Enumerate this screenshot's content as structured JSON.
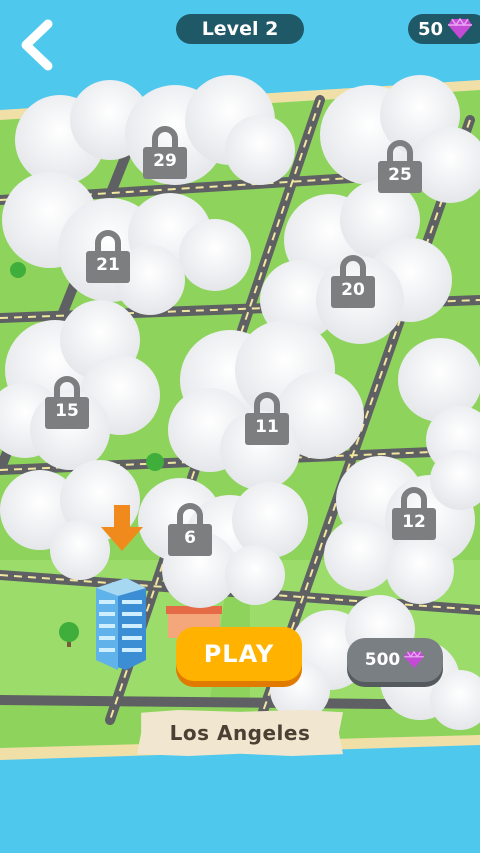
{
  "header": {
    "level_label": "Level 2",
    "gem_count": "50"
  },
  "levels": {
    "locked": [
      "29",
      "25",
      "21",
      "20",
      "15",
      "11",
      "12",
      "6"
    ]
  },
  "actions": {
    "play_label": "PLAY",
    "unlock_price": "500"
  },
  "city": {
    "name": "Los Angeles"
  },
  "colors": {
    "sky": "#4fc8ee",
    "grass": "#8ed45c",
    "road": "#5e6063",
    "play": "#ffb300",
    "gem": "#c44bd6",
    "lock": "#7c7e80"
  },
  "icons": [
    "back-arrow-icon",
    "gem-icon",
    "lock-icon",
    "down-arrow-icon",
    "building-icon",
    "tree-icon"
  ]
}
